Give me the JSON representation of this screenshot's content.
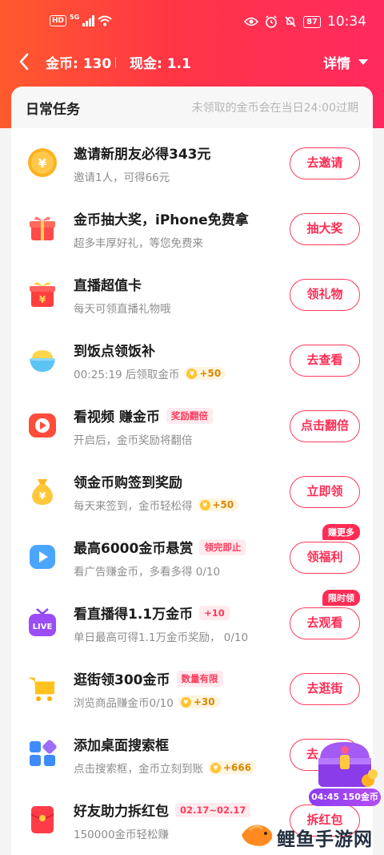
{
  "status_bar": {
    "hd": "HD",
    "net": "5G",
    "battery": "87",
    "time": "10:34"
  },
  "top_bar": {
    "coins_label": "金币: 130",
    "cash_label": "现金: 1.1",
    "detail_label": "详情"
  },
  "section": {
    "title": "日常任务",
    "note": "未领取的金币会在当日24:00过期"
  },
  "tasks": [
    {
      "title": "邀请新朋友必得343元",
      "subtitle": "邀请1人，可得66元",
      "button": "去邀请",
      "icon": "coin-yen-icon"
    },
    {
      "title": "金币抽大奖，iPhone免费拿",
      "subtitle": "超多丰厚好礼，等您免费来",
      "button": "抽大奖",
      "icon": "gift-box-icon"
    },
    {
      "title": "直播超值卡",
      "subtitle": "每天可领直播礼物哦",
      "button": "领礼物",
      "icon": "red-gift-icon"
    },
    {
      "title": "到饭点领饭补",
      "subtitle": "00:25:19 后领取金币",
      "reward": "+50",
      "button": "去查看",
      "icon": "rice-bowl-icon"
    },
    {
      "title": "看视频 赚金币",
      "tag": "奖励翻倍",
      "subtitle": "开启后，金币奖励将翻倍",
      "button": "点击翻倍",
      "icon": "video-play-icon"
    },
    {
      "title": "领金币购签到奖励",
      "subtitle": "每天来签到，金币轻松得",
      "reward": "+50",
      "button": "立即领",
      "icon": "money-bag-icon"
    },
    {
      "title": "最高6000金币悬赏",
      "tag": "领完即止",
      "subtitle": "看广告赚金币，多看多得 0/10",
      "button": "领福利",
      "badge": "赚更多",
      "icon": "blue-play-icon"
    },
    {
      "title": "看直播得1.1万金币",
      "tag": "+10",
      "subtitle": "单日最高可得1.1万金币奖励，  0/10",
      "button": "去观看",
      "badge": "限时领",
      "icon": "live-tv-icon"
    },
    {
      "title": "逛街领300金币",
      "tag": "数量有限",
      "subtitle": "浏览商品赚金币0/10",
      "reward": "+30",
      "button": "去逛街",
      "icon": "shopping-cart-icon"
    },
    {
      "title": "添加桌面搜索框",
      "subtitle": "点击搜索框，金币立刻到账",
      "reward": "+666",
      "button": "去",
      "icon": "app-grid-icon"
    },
    {
      "title": "好友助力拆红包",
      "tag": "02.17~02.17",
      "subtitle": "150000金币轻松赚",
      "button": "拆红包",
      "icon": "red-envelope-icon"
    }
  ],
  "floater": {
    "timer": "04:45 150金币"
  },
  "watermark": {
    "text": "鲤鱼手游网"
  },
  "colors": {
    "accent": "#ff2d55",
    "header_start": "#ff5a2e",
    "header_end": "#ff2a5f"
  }
}
